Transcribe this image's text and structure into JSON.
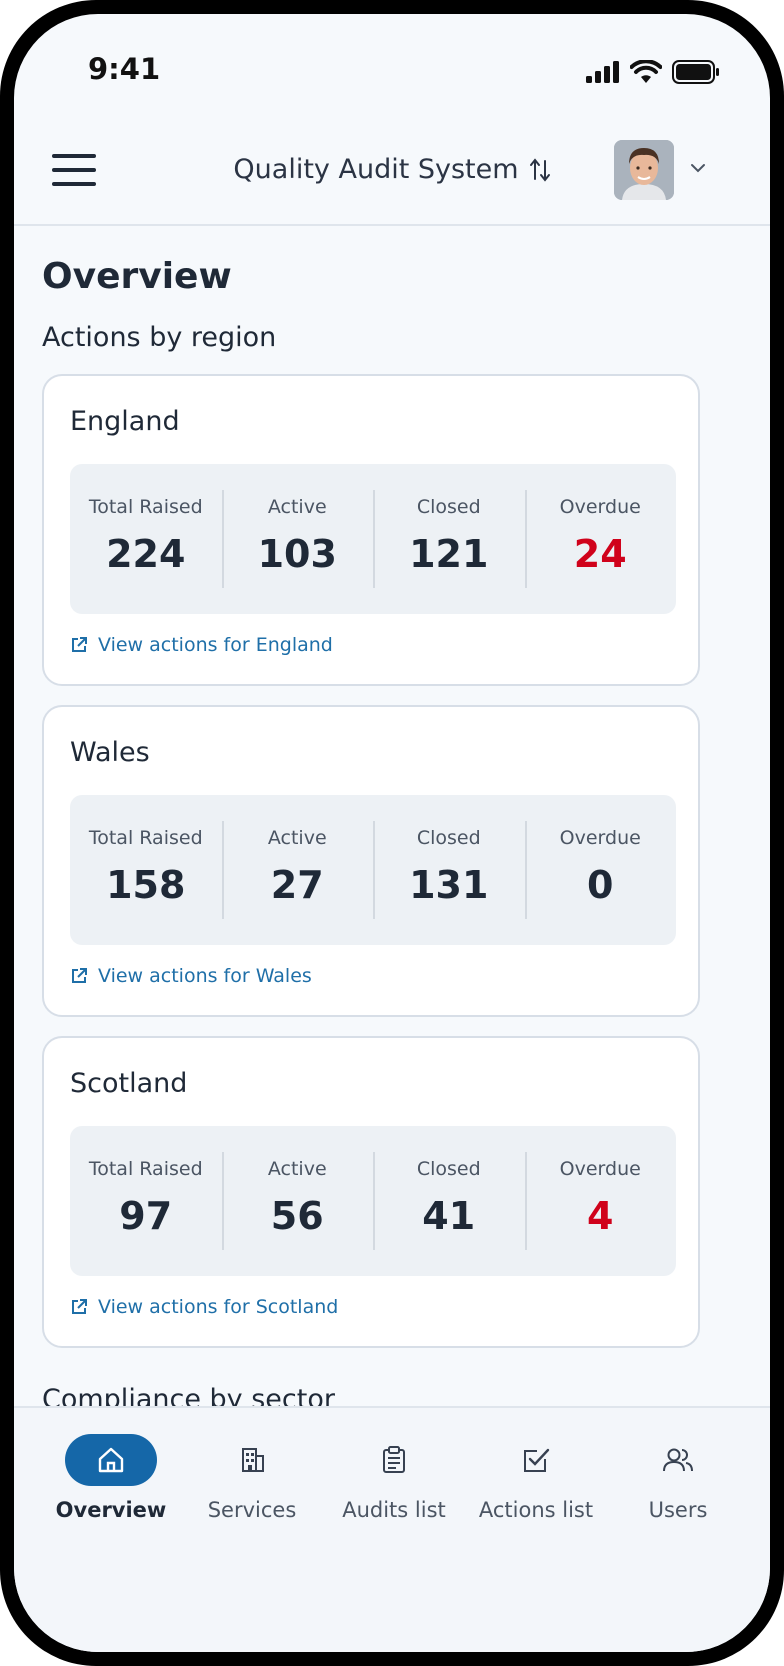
{
  "status_bar": {
    "time": "9:41"
  },
  "app_bar": {
    "title": "Quality Audit System"
  },
  "page": {
    "title": "Overview",
    "section_actions": "Actions by region",
    "section_sector": "Compliance by sector"
  },
  "regions": [
    {
      "name": "England",
      "stats": [
        {
          "label": "Total Raised",
          "value": "224"
        },
        {
          "label": "Active",
          "value": "103"
        },
        {
          "label": "Closed",
          "value": "121"
        },
        {
          "label": "Overdue",
          "value": "24"
        }
      ],
      "link": "View actions for England"
    },
    {
      "name": "Wales",
      "stats": [
        {
          "label": "Total Raised",
          "value": "158"
        },
        {
          "label": "Active",
          "value": "27"
        },
        {
          "label": "Closed",
          "value": "131"
        },
        {
          "label": "Overdue",
          "value": "0"
        }
      ],
      "link": "View actions for Wales"
    },
    {
      "name": "Scotland",
      "stats": [
        {
          "label": "Total Raised",
          "value": "97"
        },
        {
          "label": "Active",
          "value": "56"
        },
        {
          "label": "Closed",
          "value": "41"
        },
        {
          "label": "Overdue",
          "value": "4"
        }
      ],
      "link": "View actions for Scotland"
    }
  ],
  "nav": [
    {
      "label": "Overview",
      "icon": "home-icon",
      "active": true
    },
    {
      "label": "Services",
      "icon": "building-icon",
      "active": false
    },
    {
      "label": "Audits list",
      "icon": "clipboard-icon",
      "active": false
    },
    {
      "label": "Actions list",
      "icon": "checkbox-icon",
      "active": false
    },
    {
      "label": "Users",
      "icon": "users-icon",
      "active": false
    }
  ],
  "colors": {
    "accent": "#1567a8",
    "link": "#1f6fa8",
    "alert": "#d0021b",
    "text": "#1f2937"
  }
}
